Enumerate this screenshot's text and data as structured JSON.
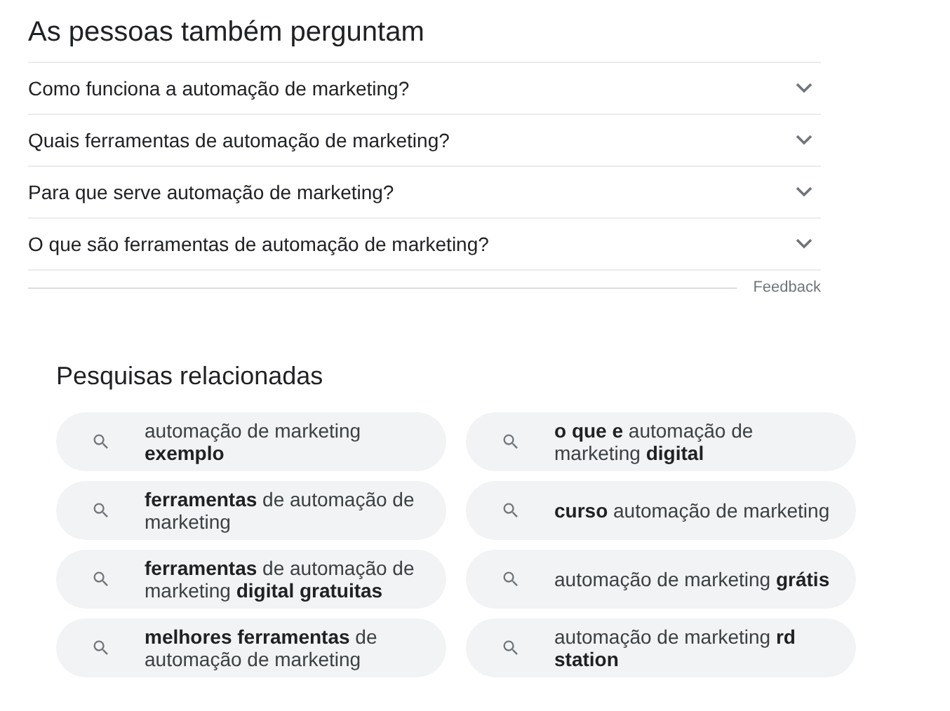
{
  "people_also_ask": {
    "title": "As pessoas também perguntam",
    "questions": [
      {
        "text": "Como funciona a automação de marketing?",
        "expanded": false
      },
      {
        "text": "Quais ferramentas de automação de marketing?",
        "expanded": false
      },
      {
        "text": "Para que serve automação de marketing?",
        "expanded": false
      },
      {
        "text": "O que são ferramentas de automação de marketing?",
        "expanded": false
      }
    ],
    "feedback": "Feedback"
  },
  "related_searches": {
    "title": "Pesquisas relacionadas",
    "items": [
      "automação de marketing **exemplo**",
      "**o que e** automação de marketing **digital**",
      "**ferramentas** de automação de marketing",
      "**curso** automação de marketing",
      "**ferramentas** de automação de marketing **digital gratuitas**",
      "automação de marketing **grátis**",
      "**melhores ferramentas** de automação de marketing",
      "automação de marketing **rd station**"
    ]
  }
}
